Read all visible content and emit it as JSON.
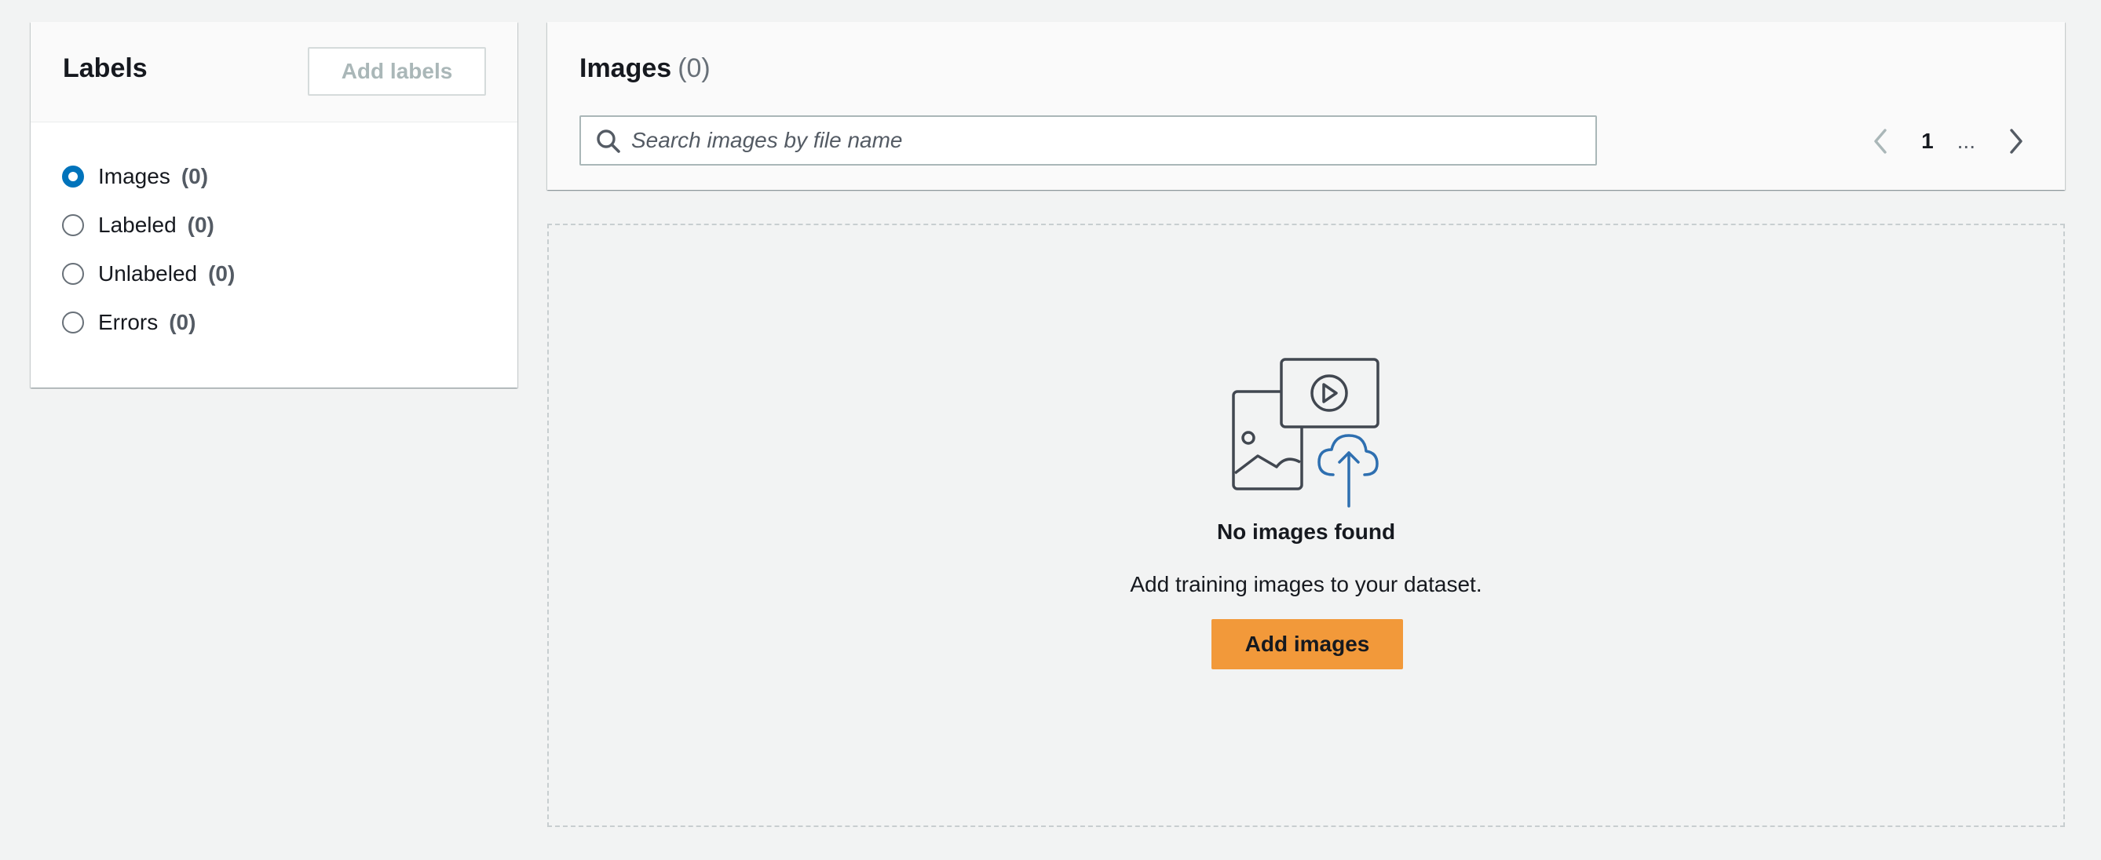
{
  "labels_panel": {
    "title": "Labels",
    "add_labels_button": "Add labels",
    "items": [
      {
        "label": "Images",
        "count": "(0)",
        "checked": true
      },
      {
        "label": "Labeled",
        "count": "(0)",
        "checked": false
      },
      {
        "label": "Unlabeled",
        "count": "(0)",
        "checked": false
      },
      {
        "label": "Errors",
        "count": "(0)",
        "checked": false
      }
    ]
  },
  "images_panel": {
    "title": "Images",
    "count": "(0)",
    "search_placeholder": "Search images by file name",
    "search_value": "",
    "pagination": {
      "prev_icon": "chevron-left-icon",
      "current_page": "1",
      "ellipsis": "...",
      "next_icon": "chevron-right-icon"
    }
  },
  "empty_state": {
    "illustration_icon": "image-video-upload-icon",
    "title": "No images found",
    "description": "Add training images to your dataset.",
    "button_label": "Add images"
  },
  "colors": {
    "background": "#f2f3f3",
    "accent_radio": "#0073bb",
    "primary_button": "#f2993a",
    "upload_cloud": "#2e6fb0"
  }
}
